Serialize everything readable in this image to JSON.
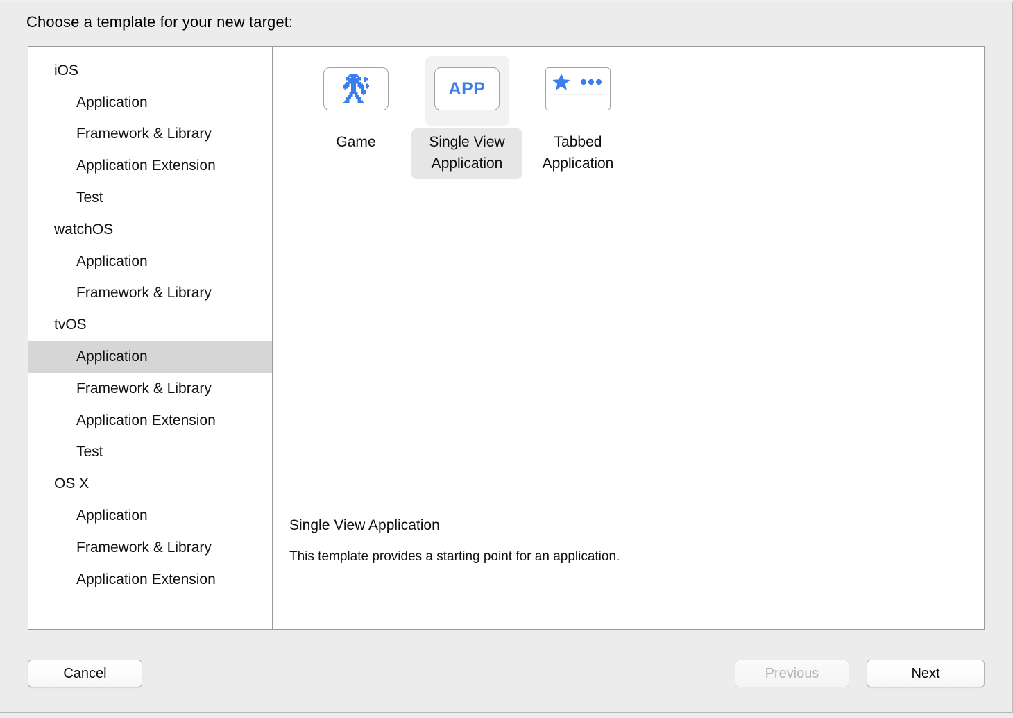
{
  "window": {
    "prompt": "Choose a template for your new target:"
  },
  "sidebar": {
    "items": [
      {
        "label": "iOS",
        "level": "group",
        "selected": false
      },
      {
        "label": "Application",
        "level": "child",
        "selected": false
      },
      {
        "label": "Framework & Library",
        "level": "child",
        "selected": false
      },
      {
        "label": "Application Extension",
        "level": "child",
        "selected": false
      },
      {
        "label": "Test",
        "level": "child",
        "selected": false
      },
      {
        "label": "watchOS",
        "level": "group",
        "selected": false
      },
      {
        "label": "Application",
        "level": "child",
        "selected": false
      },
      {
        "label": "Framework & Library",
        "level": "child",
        "selected": false
      },
      {
        "label": "tvOS",
        "level": "group",
        "selected": false
      },
      {
        "label": "Application",
        "level": "child",
        "selected": true
      },
      {
        "label": "Framework & Library",
        "level": "child",
        "selected": false
      },
      {
        "label": "Application Extension",
        "level": "child",
        "selected": false
      },
      {
        "label": "Test",
        "level": "child",
        "selected": false
      },
      {
        "label": "OS X",
        "level": "group",
        "selected": false
      },
      {
        "label": "Application",
        "level": "child",
        "selected": false
      },
      {
        "label": "Framework & Library",
        "level": "child",
        "selected": false
      },
      {
        "label": "Application Extension",
        "level": "child",
        "selected": false
      }
    ]
  },
  "templates": [
    {
      "label": "Game",
      "icon": "game-robot-sprite-icon",
      "selected": false
    },
    {
      "label": "Single View Application",
      "icon": "app-label-icon",
      "selected": true
    },
    {
      "label": "Tabbed Application",
      "icon": "star-and-dots-icon",
      "selected": false
    }
  ],
  "description": {
    "title": "Single View Application",
    "body": "This template provides a starting point for an application."
  },
  "footer": {
    "cancel_label": "Cancel",
    "previous_label": "Previous",
    "next_label": "Next",
    "previous_disabled": true
  },
  "bottom_clip": {
    "text": " "
  },
  "colors": {
    "accent_blue": "#3b7dea",
    "selection_row": "#d6d6d6",
    "selection_icon_chip": "#f2f2f2",
    "selection_label_chip": "#e6e6e6",
    "window_background": "#ececec",
    "panel_border": "#9a9a9a"
  }
}
